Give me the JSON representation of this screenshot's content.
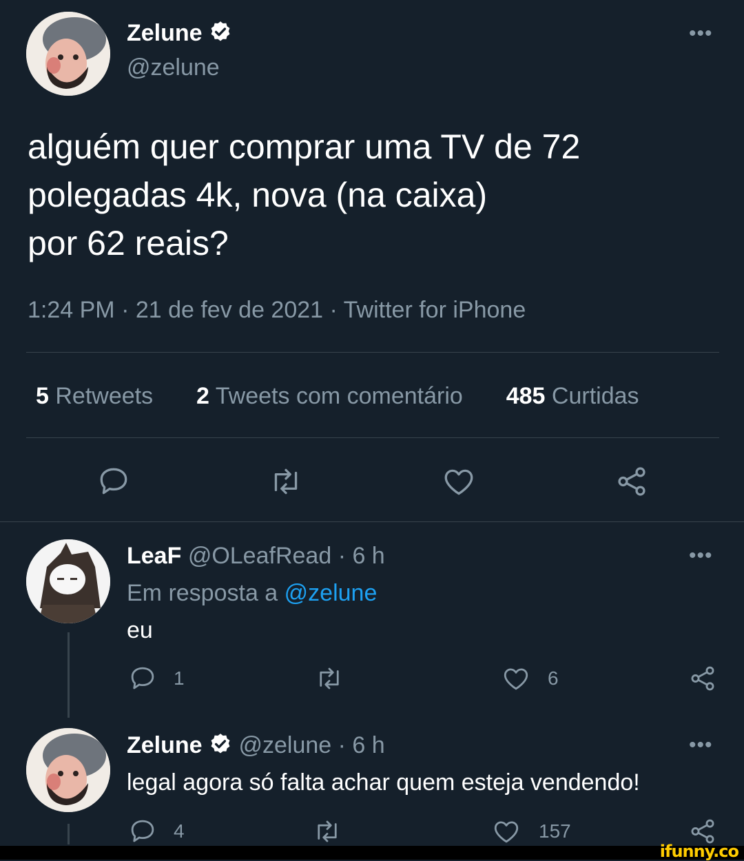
{
  "tweet": {
    "author_name": "Zelune",
    "author_handle": "@zelune",
    "text_line1": "alguém quer comprar uma TV de 72",
    "text_line2": "polegadas 4k, nova (na caixa)",
    "text_line3": "por 62 reais?",
    "meta": "1:24 PM · 21 de fev de 2021 · Twitter for iPhone",
    "stats": {
      "retweets_count": "5",
      "retweets_label": "Retweets",
      "quotes_count": "2",
      "quotes_label": "Tweets com comentário",
      "likes_count": "485",
      "likes_label": "Curtidas"
    }
  },
  "reply1": {
    "author_name": "LeaF",
    "author_handle": "@OLeafRead",
    "time": "· 6 h",
    "reply_prefix": "Em resposta a",
    "reply_mention": "@zelune",
    "text": "eu",
    "reply_count": "1",
    "like_count": "6"
  },
  "reply2": {
    "author_name": "Zelune",
    "author_handle": "@zelune",
    "time": "· 6 h",
    "text": "legal agora só falta achar quem esteja vendendo!",
    "reply_count": "4",
    "like_count": "157"
  },
  "watermark": "ifunny.co",
  "colors": {
    "background": "#15202b",
    "muted": "#8899a6",
    "link": "#1da1f2",
    "verified": "#ffffff"
  }
}
